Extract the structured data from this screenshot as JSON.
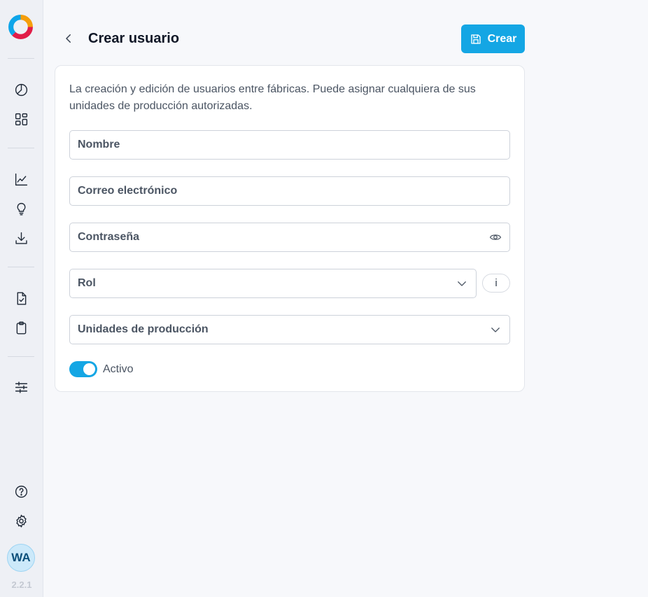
{
  "sidebar": {
    "items": [
      {
        "icon": "dashboard-gauge-icon"
      },
      {
        "icon": "grid-layout-icon"
      },
      {
        "icon": "chart-line-icon"
      },
      {
        "icon": "lightbulb-icon"
      },
      {
        "icon": "download-icon"
      },
      {
        "icon": "file-check-icon"
      },
      {
        "icon": "clipboard-icon"
      },
      {
        "icon": "sliders-icon"
      }
    ],
    "bottom": [
      {
        "icon": "help-icon"
      },
      {
        "icon": "gear-icon"
      }
    ],
    "avatar_initials": "WA",
    "version": "2.2.1"
  },
  "header": {
    "title": "Crear usuario",
    "create_label": "Crear"
  },
  "form": {
    "description": "La creación y edición de usuarios entre fábricas. Puede asignar cualquiera de sus unidades de producción autorizadas.",
    "name_placeholder": "Nombre",
    "email_placeholder": "Correo electrónico",
    "password_placeholder": "Contraseña",
    "role_placeholder": "Rol",
    "info_label": "i",
    "units_placeholder": "Unidades de producción",
    "active_label": "Activo",
    "active_on": true
  },
  "colors": {
    "accent": "#14a6e4",
    "background": "#f7f8fb"
  }
}
